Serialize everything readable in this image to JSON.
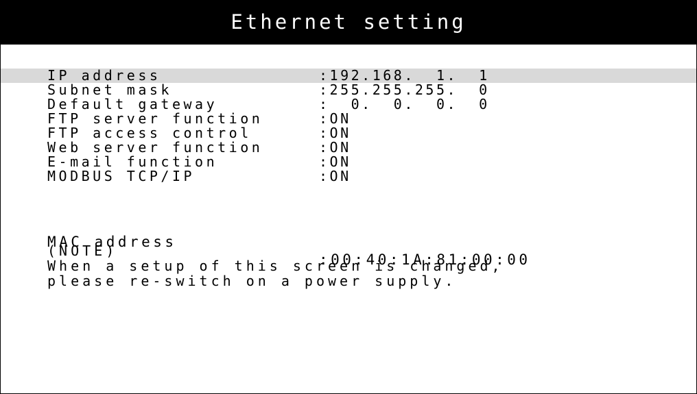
{
  "screen": {
    "title": "Ethernet setting"
  },
  "settings": [
    {
      "label": "IP address",
      "value": ":192.168.  1.  1"
    },
    {
      "label": "Subnet mask",
      "value": ":255.255.255.  0"
    },
    {
      "label": "Default gateway",
      "value": ":  0.  0.  0.  0"
    },
    {
      "label": "FTP server function",
      "value": ":ON"
    },
    {
      "label": "FTP access control",
      "value": ":ON"
    },
    {
      "label": "Web server function",
      "value": ":ON"
    },
    {
      "label": "E-mail function",
      "value": ":ON"
    },
    {
      "label": "MODBUS TCP/IP",
      "value": ":ON"
    }
  ],
  "mac": {
    "label": "MAC address",
    "value": ":00:40:1A:81:00:00"
  },
  "note": {
    "heading": "(NOTE)",
    "line1": "When a setup of this screen is changed,",
    "line2": "please re-switch on a power supply."
  },
  "colors": {
    "title_bar_bg": "#000000",
    "title_text": "#ffffff",
    "selected_row_bg": "#d9d9d9",
    "text": "#000000",
    "background": "#ffffff"
  }
}
